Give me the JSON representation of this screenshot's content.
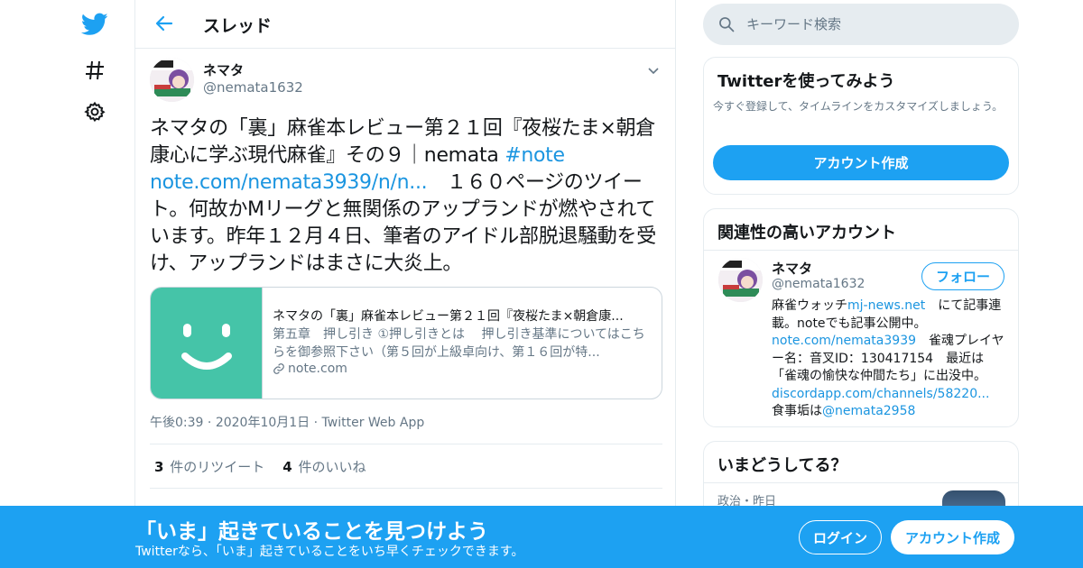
{
  "header": {
    "title": "スレッド"
  },
  "tweet": {
    "name": "ネマタ",
    "handle": "@nemata1632",
    "text_part1": "ネマタの「裏」麻雀本レビュー第２１回『夜桜たま×朝倉康心に学ぶ現代麻雀』その９｜nemata ",
    "hashtag": "#note",
    "url": "note.com/nemata3939/n/n...",
    "text_part2": "　１６０ページのツイート。何故かMリーグと無関係のアップランドが燃やされています。昨年１２月４日、筆者のアイドル部脱退騒動を受け、アップランドはまさに大炎上。",
    "card": {
      "title": "ネマタの「裏」麻雀本レビュー第２１回『夜桜たま×朝倉康...",
      "description": "第五章　押し引き ①押し引きとは　 押し引き基準についてはこちらを御参照下さい（第５回が上級卓向け、第１６回が特...",
      "domain": "note.com"
    },
    "time": "午後0:39",
    "date": "2020年10月1日",
    "source": "Twitter Web App",
    "retweets_count": "3",
    "retweets_label": "件のリツイート",
    "likes_count": "4",
    "likes_label": "件のいいね"
  },
  "search": {
    "placeholder": "キーワード検索"
  },
  "signup_panel": {
    "title": "Twitterを使ってみよう",
    "subtitle": "今すぐ登録して、タイムラインをカスタマイズしましょう。",
    "button": "アカウント作成"
  },
  "related_panel": {
    "title": "関連性の高いアカウント",
    "account": {
      "name": "ネマタ",
      "handle": "@nemata1632",
      "follow_label": "フォロー",
      "bio_1": "麻雀ウォッチ",
      "bio_link1": "mj-news.net",
      "bio_2": "　にて記事連載。noteでも記事公開中。",
      "bio_link2": "note.com/nemata3939",
      "bio_3": "　雀魂プレイヤー名：音叉ID：130417154　最近は「雀魂の愉快な仲間たち」に出没中。",
      "bio_link3": "discordapp.com/channels/58220...",
      "bio_4": "　食事垢は",
      "bio_link4": "@nemata2958"
    }
  },
  "trends_panel": {
    "title": "いまどうしてる？",
    "meta": "政治・昨日"
  },
  "banner": {
    "title": "「いま」起きていることを見つけよう",
    "subtitle": "Twitterなら、「いま」起きていることをいち早くチェックできます。",
    "login": "ログイン",
    "signup": "アカウント作成"
  },
  "colors": {
    "brand": "#1da1f2",
    "link": "#1b95e0",
    "muted": "#657786",
    "card_image": "#45c4a8"
  }
}
